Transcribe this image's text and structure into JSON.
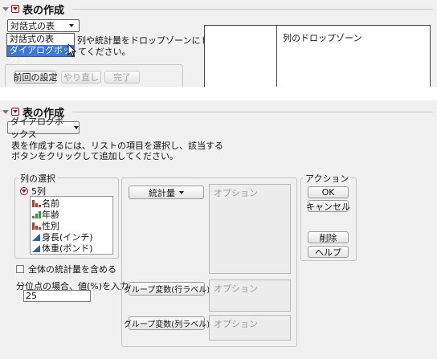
{
  "top": {
    "title": "表の作成",
    "mode_select": "対話式の表",
    "menu_items": [
      "対話式の表",
      "ダイアログボックス"
    ],
    "desc_line1": "列や統計量をドロップゾーンにド",
    "desc_line2": "てください。",
    "col_dropzone": "列のドロップゾーン",
    "btn_prev": "前回の設定",
    "btn_redo": "やり直し",
    "btn_done": "完了"
  },
  "main": {
    "title": "表の作成",
    "mode_select": "ダイアログボックス",
    "desc_line1": "表を作成するには、リストの項目を選択し、該当する",
    "desc_line2": "ボタンをクリックして追加してください。",
    "col_select_label": "列の選択",
    "col_count": "5列",
    "columns": [
      "名前",
      "年齢",
      "性別",
      "身長(インチ)",
      "体重(ポンド)"
    ],
    "checkbox_label": "全体の統計量を含める",
    "quantile_label": "分位点の場合、値(%)を入力",
    "quantile_value": "25",
    "btn_stats": "統計量",
    "btn_group_row": "グループ変数(行ラベル)",
    "btn_group_col": "グループ変数(列ラベル)",
    "option_placeholder": "オプション",
    "action_label": "アクション",
    "btn_ok": "OK",
    "btn_cancel": "キャンセル",
    "btn_remove": "削除",
    "btn_help": "ヘルプ"
  },
  "colors": {
    "nominal": "#c0392b",
    "ordinal": "#2e9e3a",
    "continuous": "#2a5fbf",
    "selection": "#3b78d8",
    "redbox": "#cc0000"
  }
}
